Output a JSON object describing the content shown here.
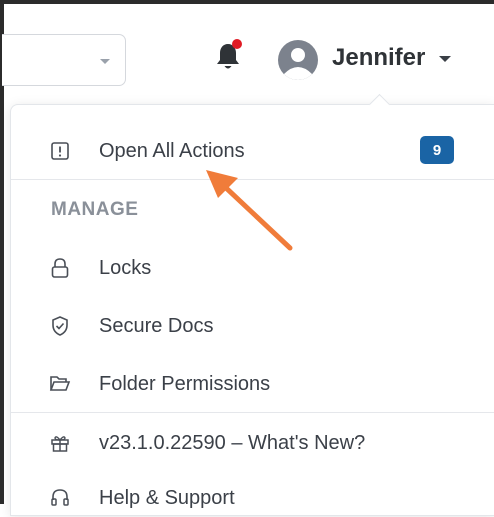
{
  "header": {
    "user_name": "Jennifer",
    "notification_dot_color": "#e01b24"
  },
  "menu": {
    "open_actions": {
      "label": "Open All Actions",
      "badge": "9",
      "badge_color": "#1a64a5",
      "icon": "alert-square-icon"
    },
    "section_header": "MANAGE",
    "items": [
      {
        "label": "Locks",
        "icon": "lock-icon"
      },
      {
        "label": "Secure Docs",
        "icon": "shield-check-icon"
      },
      {
        "label": "Folder Permissions",
        "icon": "folder-open-icon"
      }
    ],
    "whats_new": {
      "label": "v23.1.0.22590 – What's New?",
      "icon": "gift-icon"
    },
    "help": {
      "label": "Help & Support",
      "icon": "headset-icon"
    }
  },
  "annotation": {
    "arrow_color": "#f07c3a"
  }
}
